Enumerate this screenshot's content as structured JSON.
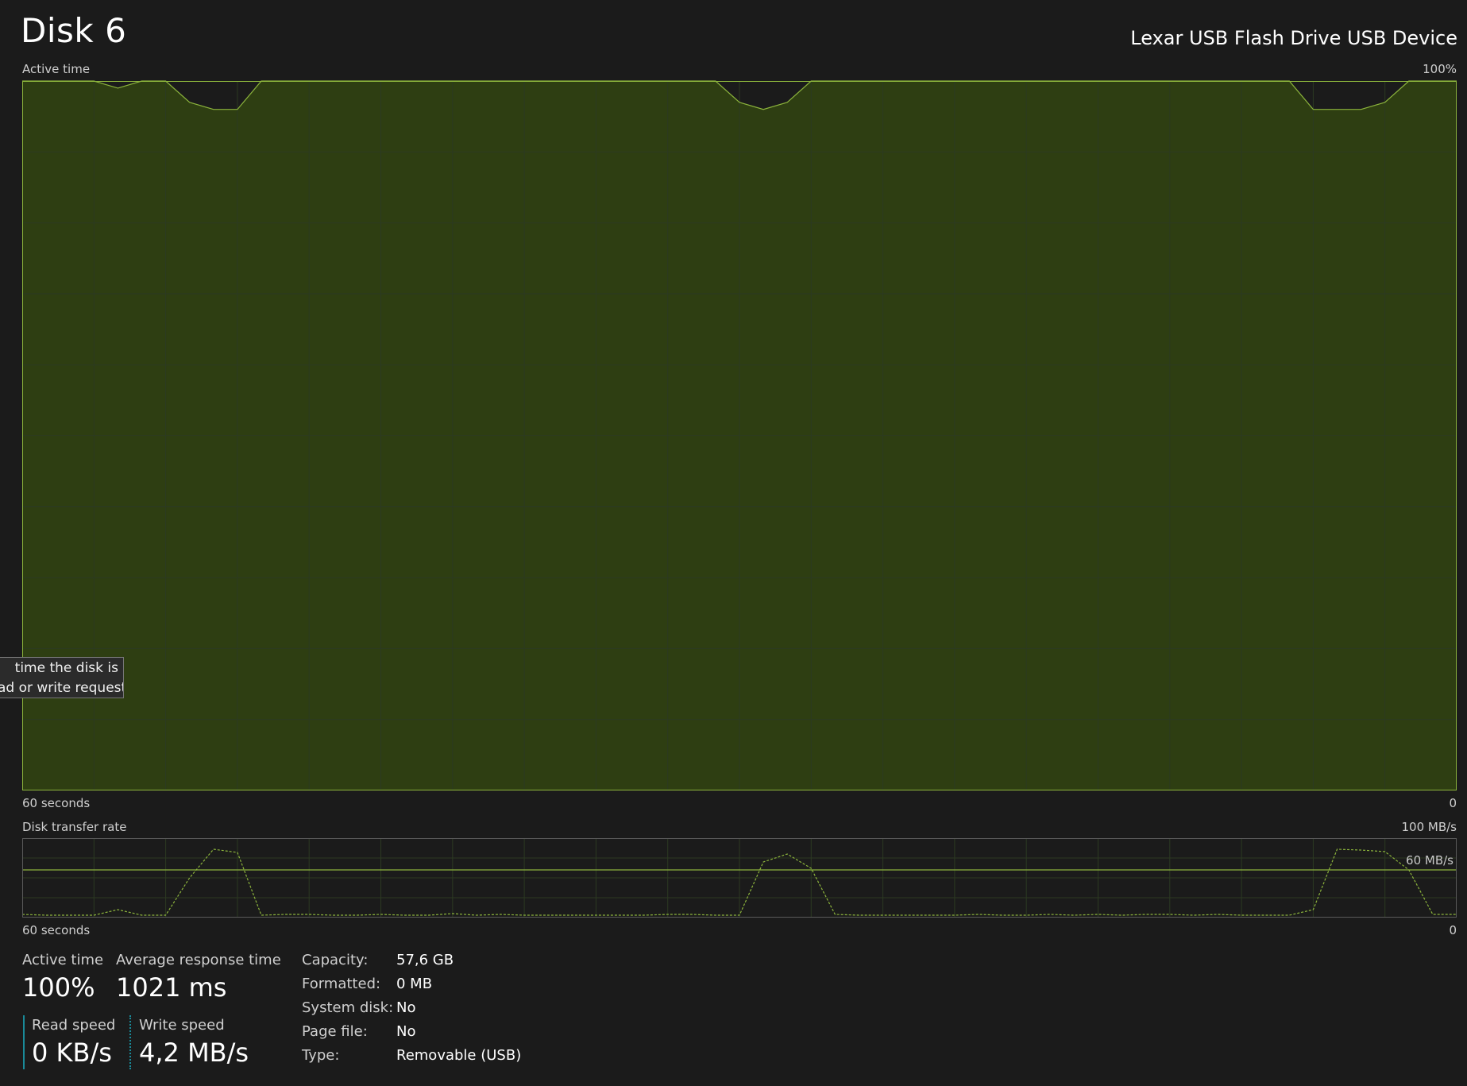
{
  "header": {
    "title": "Disk 6",
    "device": "Lexar USB Flash Drive USB Device"
  },
  "graphs": {
    "active_time_label": "Active time",
    "active_time_max": "100%",
    "active_time_x_left": "60 seconds",
    "active_time_x_right": "0",
    "transfer_label": "Disk transfer rate",
    "transfer_max": "100 MB/s",
    "transfer_ref": "60 MB/s",
    "transfer_x_left": "60 seconds",
    "transfer_x_right": "0",
    "fill_color": "#2e3e12",
    "line_color": "#8cb43c"
  },
  "tooltip": {
    "line1": "time the disk is",
    "line2": "ad or write requests"
  },
  "stats": {
    "active_time_label": "Active time",
    "active_time_value": "100%",
    "avg_response_label": "Average response time",
    "avg_response_value": "1021 ms",
    "read_speed_label": "Read speed",
    "read_speed_value": "0 KB/s",
    "write_speed_label": "Write speed",
    "write_speed_value": "4,2 MB/s"
  },
  "info": [
    {
      "label": "Capacity:",
      "value": "57,6 GB"
    },
    {
      "label": "Formatted:",
      "value": "0 MB"
    },
    {
      "label": "System disk:",
      "value": "No"
    },
    {
      "label": "Page file:",
      "value": "No"
    },
    {
      "label": "Type:",
      "value": "Removable (USB)"
    }
  ],
  "chart_data": [
    {
      "type": "area",
      "x": [
        60,
        59,
        58,
        57,
        56,
        55,
        54,
        53,
        52,
        51,
        50,
        49,
        48,
        47,
        46,
        45,
        44,
        43,
        42,
        41,
        40,
        39,
        38,
        37,
        36,
        35,
        34,
        33,
        32,
        31,
        30,
        29,
        28,
        27,
        26,
        25,
        24,
        23,
        22,
        21,
        20,
        19,
        18,
        17,
        16,
        15,
        14,
        13,
        12,
        11,
        10,
        9,
        8,
        7,
        6,
        5,
        4,
        3,
        2,
        1,
        0
      ],
      "values": [
        100,
        100,
        100,
        100,
        99,
        100,
        100,
        97,
        96,
        96,
        100,
        100,
        100,
        100,
        100,
        100,
        100,
        100,
        100,
        100,
        100,
        100,
        100,
        100,
        100,
        100,
        100,
        100,
        100,
        100,
        97,
        96,
        97,
        100,
        100,
        100,
        100,
        100,
        100,
        100,
        100,
        100,
        100,
        100,
        100,
        100,
        100,
        100,
        100,
        100,
        100,
        100,
        100,
        100,
        96,
        96,
        96,
        97,
        100,
        100,
        100
      ],
      "xlabel": "60 seconds",
      "ylim": [
        0,
        100
      ]
    },
    {
      "type": "line",
      "x": [
        60,
        59,
        58,
        57,
        56,
        55,
        54,
        53,
        52,
        51,
        50,
        49,
        48,
        47,
        46,
        45,
        44,
        43,
        42,
        41,
        40,
        39,
        38,
        37,
        36,
        35,
        34,
        33,
        32,
        31,
        30,
        29,
        28,
        27,
        26,
        25,
        24,
        23,
        22,
        21,
        20,
        19,
        18,
        17,
        16,
        15,
        14,
        13,
        12,
        11,
        10,
        9,
        8,
        7,
        6,
        5,
        4,
        3,
        2,
        1,
        0
      ],
      "values": [
        4,
        3,
        3,
        3,
        10,
        3,
        3,
        50,
        86,
        82,
        3,
        4,
        4,
        3,
        3,
        4,
        3,
        3,
        5,
        3,
        4,
        3,
        3,
        3,
        3,
        3,
        3,
        4,
        4,
        3,
        3,
        70,
        80,
        62,
        4,
        3,
        3,
        3,
        3,
        3,
        4,
        3,
        3,
        4,
        3,
        4,
        3,
        4,
        4,
        3,
        4,
        3,
        3,
        3,
        10,
        86,
        85,
        83,
        60,
        4,
        4
      ],
      "xlabel": "60 seconds",
      "ylim": [
        0,
        100
      ],
      "reference_line": 60
    }
  ]
}
